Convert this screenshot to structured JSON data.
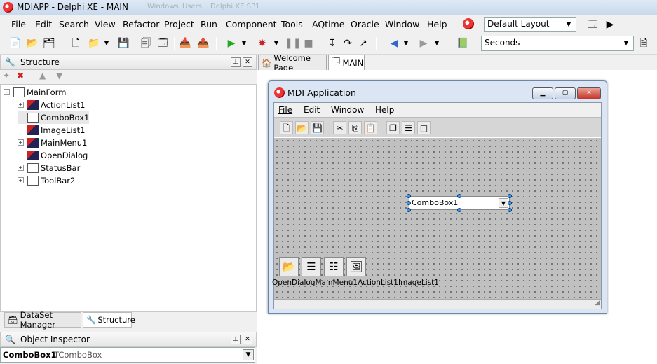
{
  "window": {
    "title": "MDIAPP - Delphi XE - MAIN",
    "ghost_tabs": [
      "Windows",
      "Users",
      "Delphi XE SP1"
    ]
  },
  "menu": [
    "File",
    "Edit",
    "Search",
    "View",
    "Refactor",
    "Project",
    "Run",
    "Component",
    "Tools",
    "AQtime",
    "Oracle",
    "Window",
    "Help"
  ],
  "layout_combo": {
    "value": "Default Layout"
  },
  "seconds_combo": {
    "value": "Seconds"
  },
  "structure": {
    "title": "Structure",
    "tree": [
      {
        "label": "MainForm",
        "expander": "-"
      },
      {
        "label": "ActionList1",
        "expander": "+"
      },
      {
        "label": "ComboBox1",
        "expander": ""
      },
      {
        "label": "ImageList1",
        "expander": ""
      },
      {
        "label": "MainMenu1",
        "expander": "+"
      },
      {
        "label": "OpenDialog",
        "expander": ""
      },
      {
        "label": "StatusBar",
        "expander": "+"
      },
      {
        "label": "ToolBar2",
        "expander": "+"
      }
    ],
    "tabs": [
      "DataSet Manager",
      "Structure"
    ]
  },
  "object_inspector": {
    "title": "Object Inspector",
    "selected_name": "ComboBox1",
    "selected_type": "TComboBox"
  },
  "doc_tabs": [
    "Welcome Page",
    "MAIN"
  ],
  "mdi_form": {
    "caption": "MDI Application",
    "menu": [
      "File",
      "Edit",
      "Window",
      "Help"
    ],
    "combobox_text": "ComboBox1",
    "nonvisual": [
      "OpenDialog",
      "MainMenu1",
      "ActionList1",
      "ImageList1"
    ],
    "nonvisual_caption": "OpenDialogMainMenu1ActionList1ImageList1"
  },
  "colors": {
    "accent": "#3399ff",
    "grid": "#c0c0c0"
  }
}
